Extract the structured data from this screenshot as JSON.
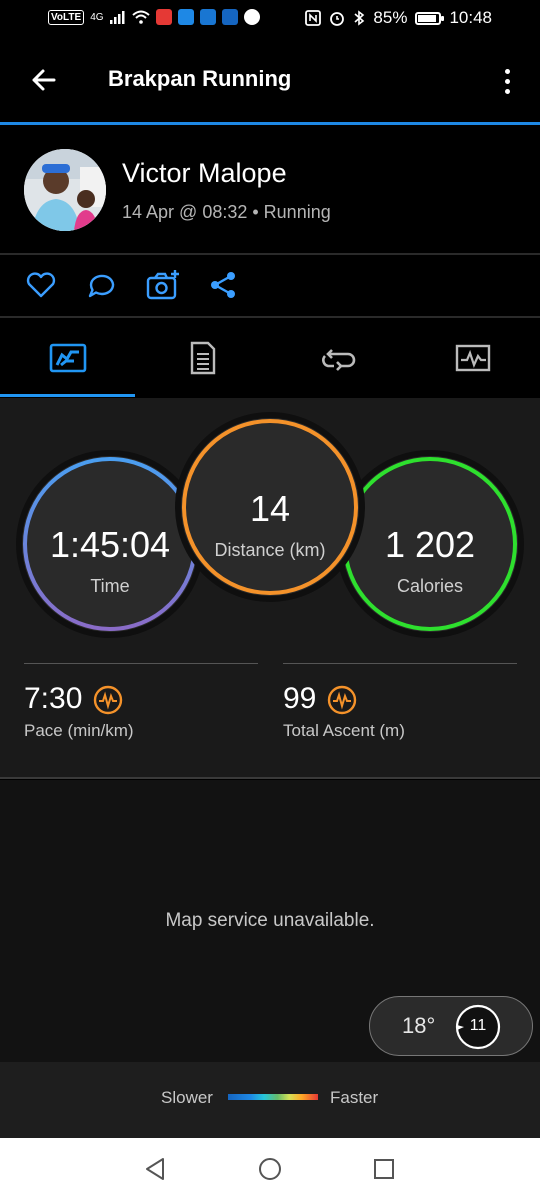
{
  "status_bar": {
    "volte": "VoLTE",
    "network": "4G",
    "battery": "85%",
    "time": "10:48"
  },
  "app_bar": {
    "title": "Brakpan Running"
  },
  "profile": {
    "name": "Victor Malope",
    "date": "14 Apr @ 08:32",
    "activity": "Running"
  },
  "tabs": [
    {
      "icon": "overview-icon",
      "active": true
    },
    {
      "icon": "details-list-icon",
      "active": false
    },
    {
      "icon": "laps-icon",
      "active": false
    },
    {
      "icon": "charts-icon",
      "active": false
    }
  ],
  "stats": {
    "time": {
      "value": "1:45:04",
      "label": "Time"
    },
    "distance": {
      "value": "14",
      "label": "Distance (km)"
    },
    "calories": {
      "value": "1 202",
      "label": "Calories"
    },
    "pace": {
      "value": "7:30",
      "label": "Pace (min/km)"
    },
    "ascent": {
      "value": "99",
      "label": "Total Ascent (m)"
    }
  },
  "map": {
    "message": "Map service unavailable.",
    "temperature": "18°",
    "wind_speed": "11"
  },
  "legend": {
    "slower": "Slower",
    "faster": "Faster"
  },
  "colors": {
    "accent": "#1e88e5",
    "time_ring": "#4a8fe0",
    "distance_ring": "#f4922a",
    "calories_ring": "#2ee02e",
    "chart_icon": "#f4922a"
  }
}
